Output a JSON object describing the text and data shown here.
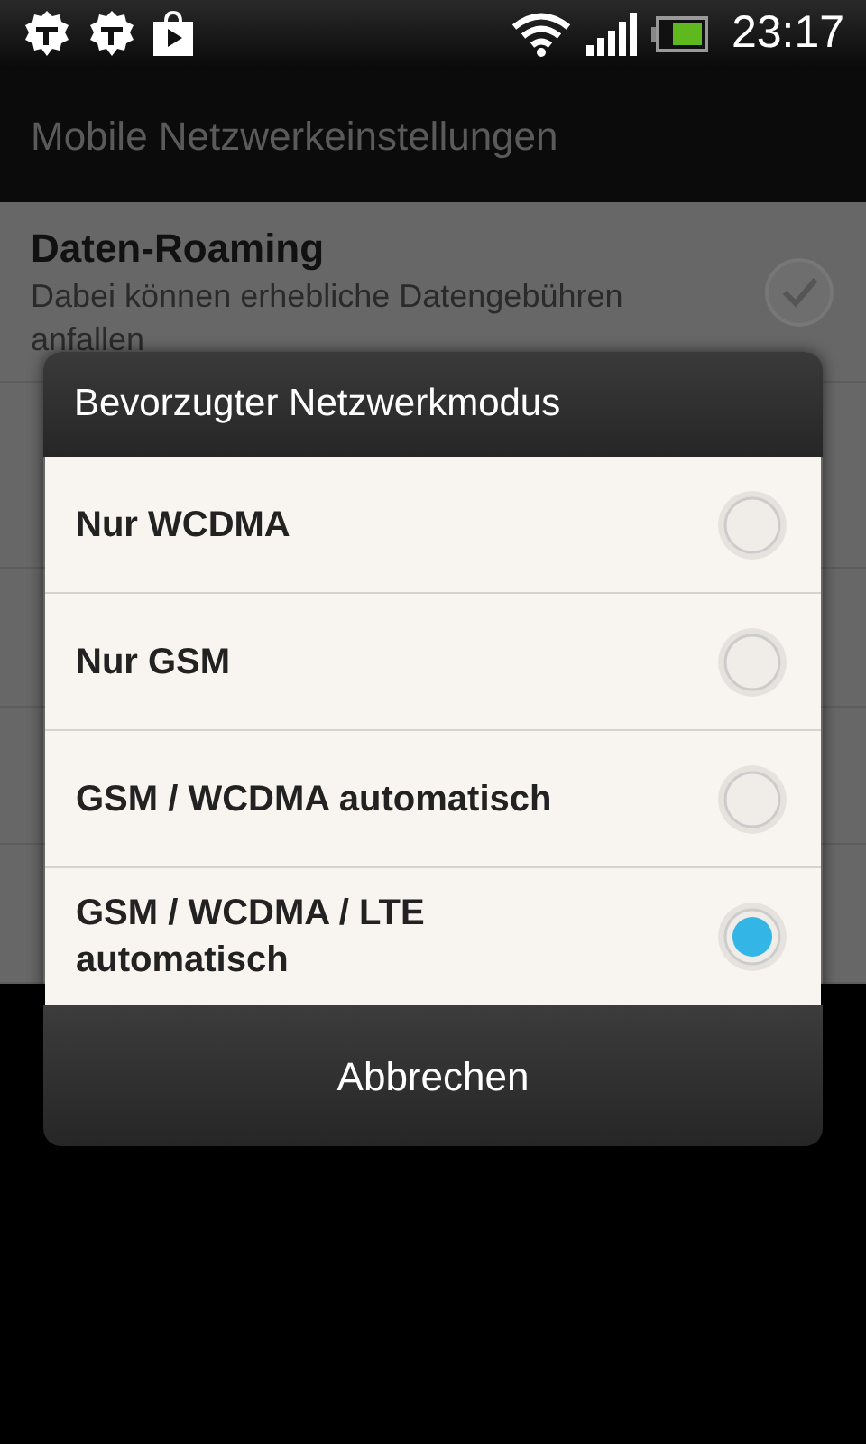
{
  "status_bar": {
    "time": "23:17"
  },
  "header": {
    "title": "Mobile Netzwerkeinstellungen"
  },
  "settings": [
    {
      "title": "Daten-Roaming",
      "summary": [
        "Dabei können erhebliche Datengebühren",
        "anfallen"
      ],
      "checked": false
    }
  ],
  "dialog": {
    "title": "Bevorzugter Netzwerkmodus",
    "options": [
      {
        "label": "Nur WCDMA",
        "selected": false
      },
      {
        "label": "Nur GSM",
        "selected": false
      },
      {
        "label": "GSM / WCDMA automatisch",
        "selected": false
      },
      {
        "label": "GSM / WCDMA / LTE automatisch",
        "selected": true
      }
    ],
    "cancel": "Abbrechen"
  }
}
